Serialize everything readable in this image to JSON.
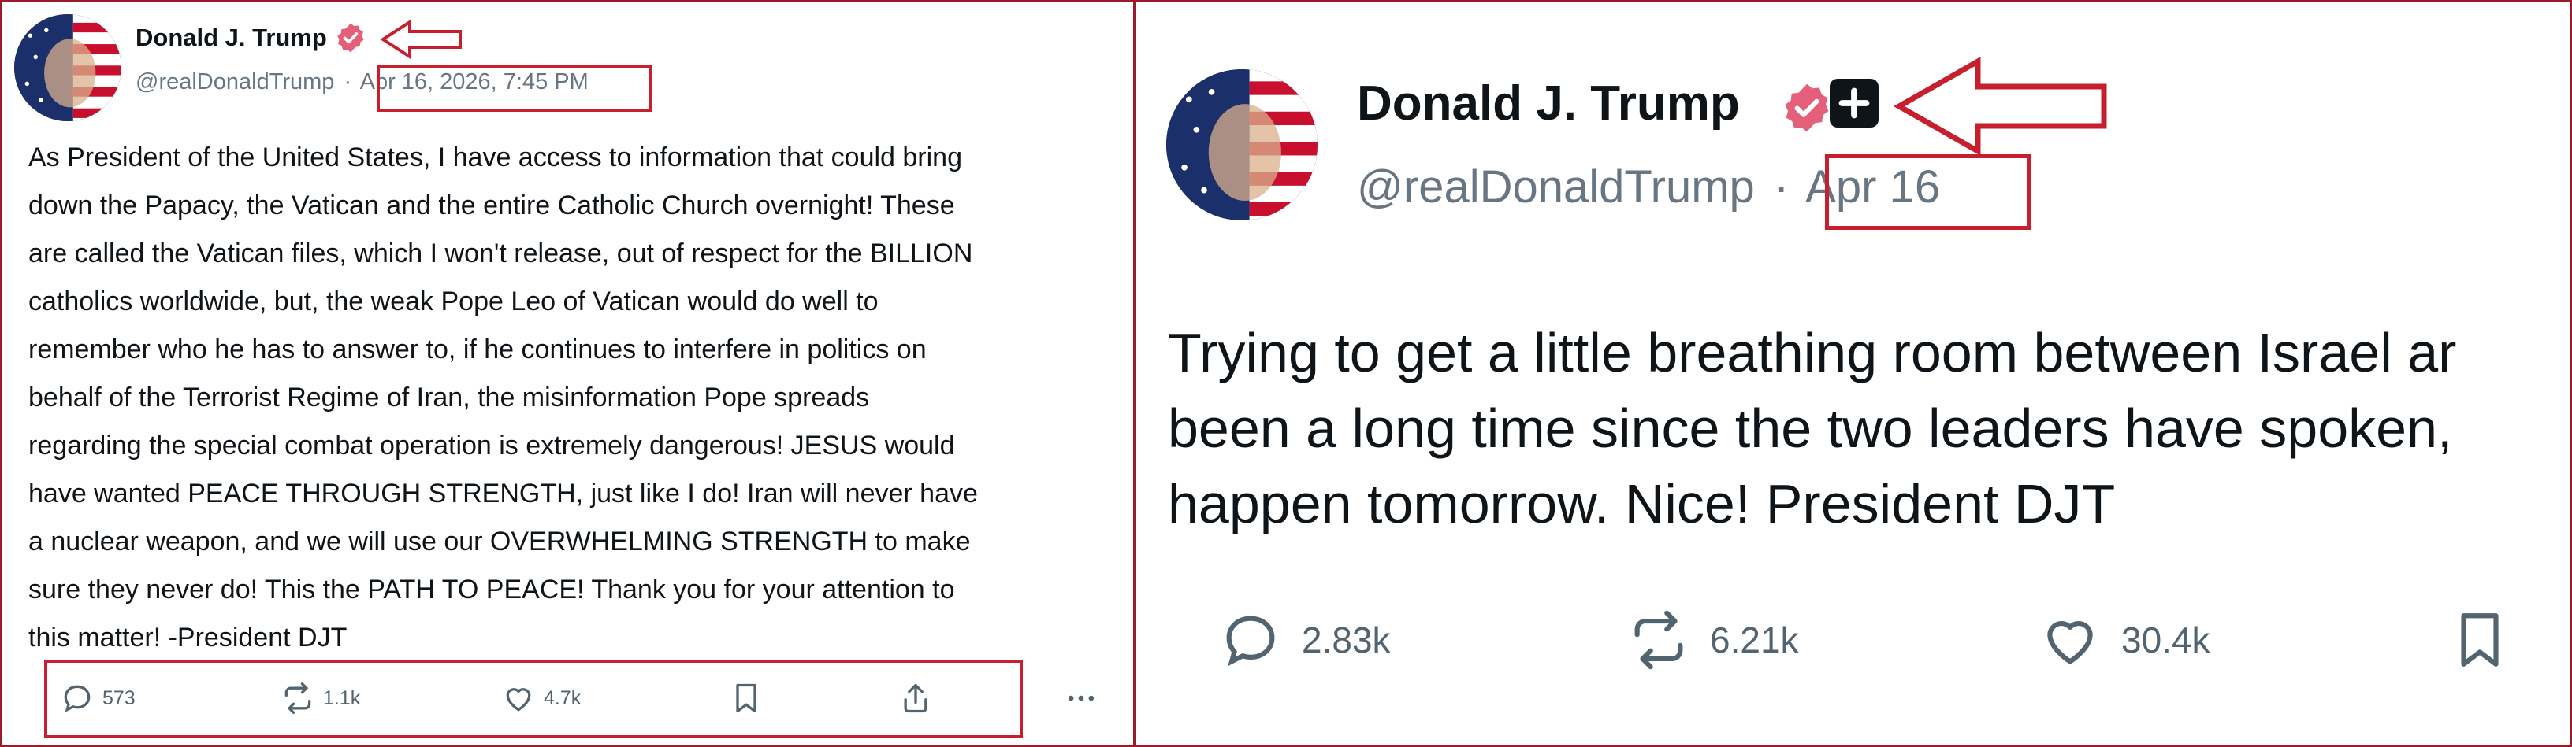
{
  "left_post": {
    "display_name": "Donald J. Trump",
    "handle": "@realDonaldTrump",
    "separator": "·",
    "timestamp": "Apr 16, 2026, 7:45 PM",
    "body_lines": [
      "As President of the United States, I have access to information that could bring",
      "down the Papacy, the Vatican and the entire Catholic Church overnight! These",
      "are called the Vatican files, which I won't release, out of respect for the BILLION",
      "catholics worldwide, but, the weak Pope Leo of Vatican would do well to",
      "remember who he has to answer to, if he continues to interfere in politics on",
      "behalf of the Terrorist Regime of Iran, the misinformation Pope spreads",
      "regarding the special combat operation is extremely dangerous! JESUS would",
      "have wanted PEACE THROUGH STRENGTH, just like I do! Iran will never have",
      "a nuclear weapon, and we will use our OVERWHELMING STRENGTH to make",
      "sure they never do! This the PATH TO PEACE! Thank you for your attention to",
      "this matter! -President DJT"
    ],
    "replies": "573",
    "reposts": "1.1k",
    "likes": "4.7k"
  },
  "right_post": {
    "display_name": "Donald J. Trump",
    "handle": "@realDonaldTrump",
    "separator": "·",
    "timestamp": "Apr 16",
    "body_lines": [
      "Trying to get a little breathing room between Israel ar",
      "been a long time since the two leaders have spoken,",
      "happen tomorrow. Nice! President DJT"
    ],
    "replies": "2.83k",
    "reposts": "6.21k",
    "likes": "30.4k"
  },
  "icons": {
    "verified_badge": "verified-badge-icon",
    "reply": "reply-icon",
    "repost": "repost-icon",
    "like": "heart-icon",
    "bookmark": "bookmark-icon",
    "share": "share-icon",
    "more": "more-icon",
    "annotation_arrow": "arrow-icon"
  },
  "colors": {
    "annotation_red": "#c71f2e",
    "verified_pink": "#e4607a",
    "frame_border": "#9a1c2a",
    "muted_text": "#687684"
  }
}
